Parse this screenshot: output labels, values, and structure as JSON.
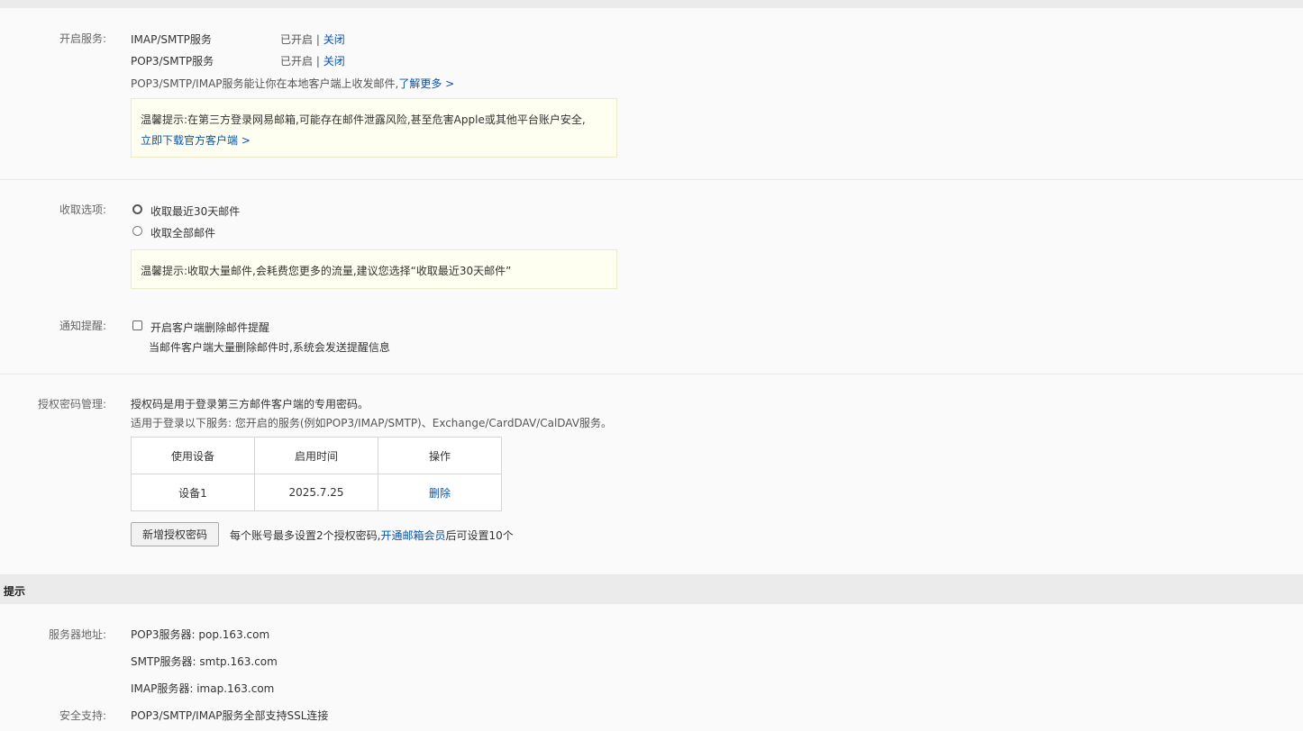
{
  "services": {
    "label": "开启服务:",
    "imap": {
      "name": "IMAP/SMTP服务",
      "status": "已开启",
      "sep": "|",
      "action": "关闭"
    },
    "pop3": {
      "name": "POP3/SMTP服务",
      "status": "已开启",
      "sep": "|",
      "action": "关闭"
    },
    "desc": "POP3/SMTP/IMAP服务能让你在本地客户端上收发邮件,",
    "learn_more": "了解更多 >",
    "tip_text": "温馨提示:在第三方登录网易邮箱,可能存在邮件泄露风险,甚至危害Apple或其他平台账户安全,",
    "tip_link": "立即下载官方客户端 >"
  },
  "receive": {
    "label": "收取选项:",
    "option_recent": "收取最近30天邮件",
    "option_all": "收取全部邮件",
    "tip_text": "温馨提示:收取大量邮件,会耗费您更多的流量,建议您选择“收取最近30天邮件”"
  },
  "notify": {
    "label": "通知提醒:",
    "checkbox_label": "开启客户端删除邮件提醒",
    "desc": "当邮件客户端大量删除邮件时,系统会发送提醒信息"
  },
  "auth": {
    "label": "授权密码管理:",
    "line1": "授权码是用于登录第三方邮件客户端的专用密码。",
    "line2": "适用于登录以下服务: 您开启的服务(例如POP3/IMAP/SMTP)、Exchange/CardDAV/CalDAV服务。",
    "table": {
      "headers": [
        "使用设备",
        "启用时间",
        "操作"
      ],
      "rows": [
        {
          "device": "设备1",
          "date": "2025.7.25",
          "action": "删除"
        }
      ]
    },
    "add_button": "新增授权密码",
    "note_prefix": "每个账号最多设置2个授权密码,",
    "note_link": "开通邮箱会员",
    "note_suffix": "后可设置10个"
  },
  "hint": {
    "title": "提示",
    "server_label": "服务器地址:",
    "pop3": "POP3服务器: pop.163.com",
    "smtp": "SMTP服务器: smtp.163.com",
    "imap": "IMAP服务器: imap.163.com",
    "security_label": "安全支持:",
    "security_text": "POP3/SMTP/IMAP服务全部支持SSL连接"
  }
}
